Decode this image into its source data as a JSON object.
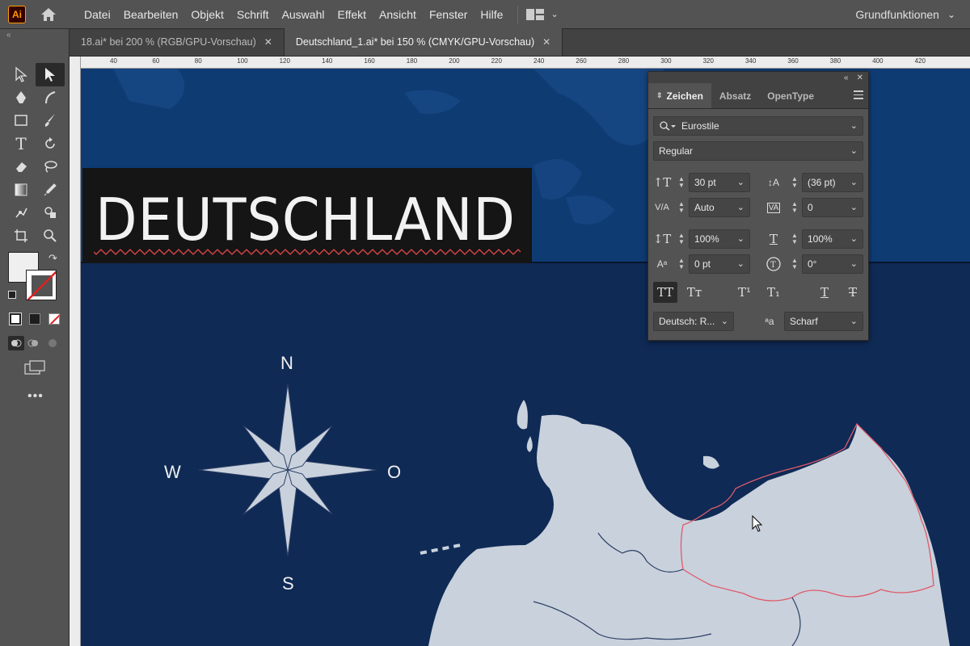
{
  "app": {
    "logo_text": "Ai"
  },
  "menu": {
    "items": [
      "Datei",
      "Bearbeiten",
      "Objekt",
      "Schrift",
      "Auswahl",
      "Effekt",
      "Ansicht",
      "Fenster",
      "Hilfe"
    ],
    "workspace": "Grundfunktionen"
  },
  "tabs": [
    {
      "label": "18.ai* bei 200 % (RGB/GPU-Vorschau)",
      "active": false
    },
    {
      "label": "Deutschland_1.ai* bei 150 % (CMYK/GPU-Vorschau)",
      "active": true
    }
  ],
  "ruler": {
    "top_labels": [
      "40",
      "60",
      "80",
      "100",
      "120",
      "140",
      "160",
      "180",
      "200",
      "220",
      "240",
      "260",
      "280",
      "300",
      "320",
      "340",
      "360",
      "380",
      "400",
      "420"
    ]
  },
  "canvas": {
    "title": "DEUTSCHLAND",
    "compass": {
      "north": "N",
      "south": "S",
      "west": "W",
      "east": "O"
    },
    "colors": {
      "ocean": "#0f2a55",
      "land": "#c9d1dc",
      "border": "#e05a6a",
      "title_bg": "#151515"
    }
  },
  "panel": {
    "tabs": [
      "Zeichen",
      "Absatz",
      "OpenType"
    ],
    "active_tab": "Zeichen",
    "font_family": "Eurostile",
    "font_style": "Regular",
    "font_size": "30 pt",
    "leading": "(36 pt)",
    "kerning": "Auto",
    "tracking": "0",
    "vertical_scale": "100%",
    "horizontal_scale": "100%",
    "baseline_shift": "0 pt",
    "rotation": "0°",
    "language": "Deutsch: R...",
    "antialiasing": "Scharf",
    "style_buttons": [
      "TT",
      "Tт",
      "T¹",
      "T₁",
      "T",
      "T"
    ]
  }
}
